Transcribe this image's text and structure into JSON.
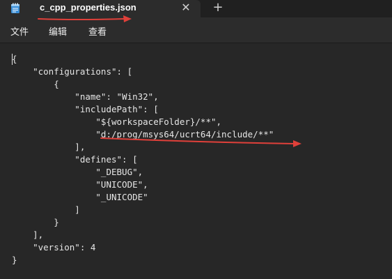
{
  "tab": {
    "title": "c_cpp_properties.json",
    "close_symbol": "✕",
    "new_tab_symbol": "+"
  },
  "menu": {
    "file": "文件",
    "edit": "编辑",
    "view": "查看"
  },
  "code": {
    "lines": [
      "{",
      "    \"configurations\": [",
      "        {",
      "            \"name\": \"Win32\",",
      "            \"includePath\": [",
      "                \"${workspaceFolder}/**\",",
      "                \"d:/prog/msys64/ucrt64/include/**\"",
      "            ],",
      "            \"defines\": [",
      "                \"_DEBUG\",",
      "                \"UNICODE\",",
      "                \"_UNICODE\"",
      "            ]",
      "        }",
      "    ],",
      "    \"version\": 4",
      "}"
    ]
  },
  "colors": {
    "annotation_red": "#e0403a",
    "editor_bg": "#272727",
    "text": "#e6e6e6"
  }
}
